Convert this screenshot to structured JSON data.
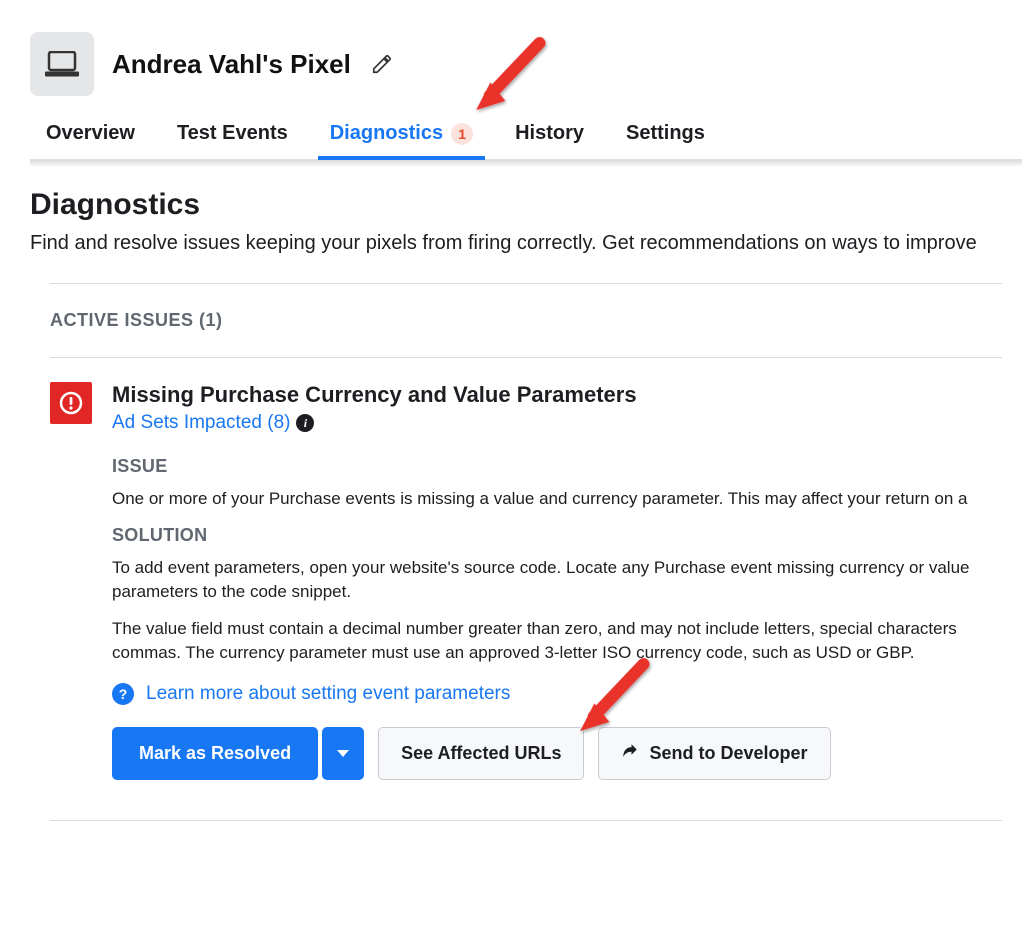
{
  "header": {
    "pixel_title": "Andrea Vahl's Pixel"
  },
  "tabs": {
    "overview": "Overview",
    "test_events": "Test Events",
    "diagnostics": "Diagnostics",
    "diagnostics_badge": "1",
    "history": "History",
    "settings": "Settings"
  },
  "section": {
    "title": "Diagnostics",
    "subtitle": "Find and resolve issues keeping your pixels from firing correctly. Get recommendations on ways to improve",
    "active_issues_label": "ACTIVE ISSUES (1)"
  },
  "issue": {
    "title": "Missing Purchase Currency and Value Parameters",
    "adsets_link": "Ad Sets Impacted (8)",
    "issue_heading": "ISSUE",
    "issue_text": "One or more of your Purchase events is missing a value and currency parameter. This may affect your return on a",
    "solution_heading": "SOLUTION",
    "solution_text_1a": "To add event parameters, open your website's source code. Locate any Purchase event missing currency or value",
    "solution_text_1b": "parameters to the code snippet.",
    "solution_text_2a": "The value field must contain a decimal number greater than zero, and may not include letters, special characters",
    "solution_text_2b": "commas. The currency parameter must use an approved 3-letter ISO currency code, such as USD or GBP.",
    "learn_more": "Learn more about setting event parameters",
    "buttons": {
      "mark_resolved": "Mark as Resolved",
      "see_urls": "See Affected URLs",
      "send_dev": "Send to Developer"
    }
  },
  "colors": {
    "primary": "#1877f2",
    "alert": "#e02726",
    "arrow": "#e8332a"
  }
}
